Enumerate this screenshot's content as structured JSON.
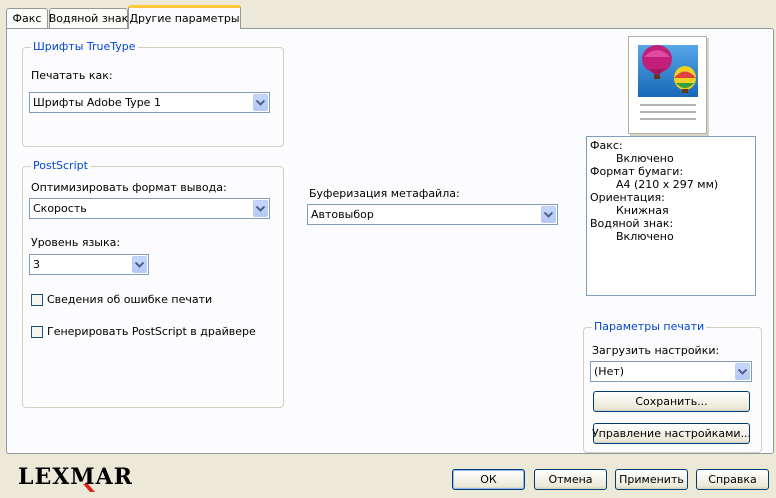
{
  "tabs": [
    {
      "label": "Факс",
      "active": false
    },
    {
      "label": "Водяной знак",
      "active": false
    },
    {
      "label": "Другие параметры",
      "active": true
    }
  ],
  "truetype": {
    "title": "Шрифты TrueType",
    "print_as_label": "Печатать как:",
    "print_as_value": "Шрифты Adobe Type 1"
  },
  "postscript": {
    "title": "PostScript",
    "optimize_label": "Оптимизировать формат вывода:",
    "optimize_value": "Скорость",
    "language_label": "Уровень языка:",
    "language_value": "3",
    "error_info_label": "Сведения об ошибке печати",
    "error_info_checked": false,
    "generate_label": "Генерировать PostScript в драйвере",
    "generate_checked": false
  },
  "metafile": {
    "label": "Буферизация метафайла:",
    "value": "Автовыбор"
  },
  "summary": {
    "fax_label": "Факс:",
    "fax_value": "Включено",
    "paper_label": "Формат бумаги:",
    "paper_value": "A4 (210 x 297 мм)",
    "orientation_label": "Ориентация:",
    "orientation_value": "Книжная",
    "watermark_label": "Водяной знак:",
    "watermark_value": "Включено"
  },
  "print_settings": {
    "title": "Параметры печати",
    "load_label": "Загрузить настройки:",
    "load_value": "(Нет)",
    "save_button": "Сохранить...",
    "manage_button": "Управление настройками..."
  },
  "footer": {
    "brand": "LEXMARK",
    "ok_button": "ОК",
    "cancel_button": "Отмена",
    "apply_button": "Применить",
    "help_button": "Справка"
  },
  "colors": {
    "accent_title": "#0046d5",
    "active_tab_highlight": "#ffc83c",
    "brand_red": "#e2231a"
  }
}
